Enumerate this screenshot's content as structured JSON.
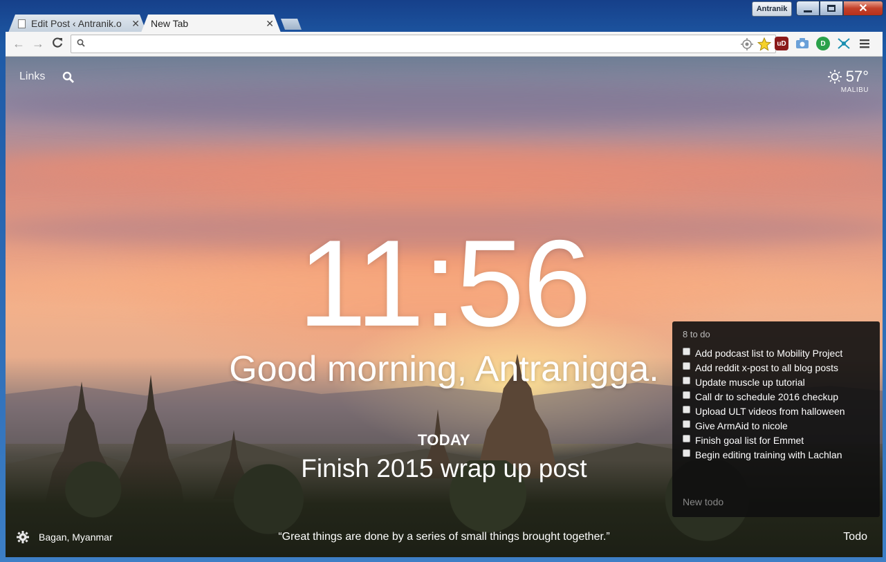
{
  "window": {
    "profile_name": "Antranik",
    "controls": {
      "minimize": "",
      "maximize": "",
      "close": "✕"
    }
  },
  "tabs": [
    {
      "label": "Edit Post ‹ Antranik.o",
      "active": false
    },
    {
      "label": "New Tab",
      "active": true
    }
  ],
  "toolbar": {
    "back": "←",
    "forward": "→",
    "reload": "C",
    "omnibox_value": "",
    "extensions": [
      {
        "icon": "ublock-icon",
        "text": "uD",
        "color": "#8b1a1a"
      },
      {
        "icon": "camera-icon",
        "text": "",
        "color": "#6aa0d8"
      },
      {
        "icon": "d-extension-icon",
        "text": "D",
        "color": "#2aa14a"
      },
      {
        "icon": "network-icon",
        "text": "",
        "color": "#1a8fb0"
      }
    ]
  },
  "dashboard": {
    "links_label": "Links",
    "weather": {
      "temperature": "57°",
      "location": "MALIBU"
    },
    "clock": "11:56",
    "greeting": "Good morning, Antranigga.",
    "focus": {
      "label": "TODAY",
      "text": "Finish 2015 wrap up post"
    },
    "photo_location": "Bagan, Myanmar",
    "quote": "“Great things are done by a series of small things brought together.”",
    "todo_link": "Todo"
  },
  "todo": {
    "count_label": "8 to do",
    "items": [
      "Add podcast list to Mobility Project",
      "Add reddit x-post to all blog posts",
      "Update muscle up tutorial",
      "Call dr to schedule 2016 checkup",
      "Upload ULT videos from halloween",
      "Give ArmAid to nicole",
      "Finish goal list for Emmet",
      "Begin editing training with Lachlan"
    ],
    "new_placeholder": "New todo"
  }
}
